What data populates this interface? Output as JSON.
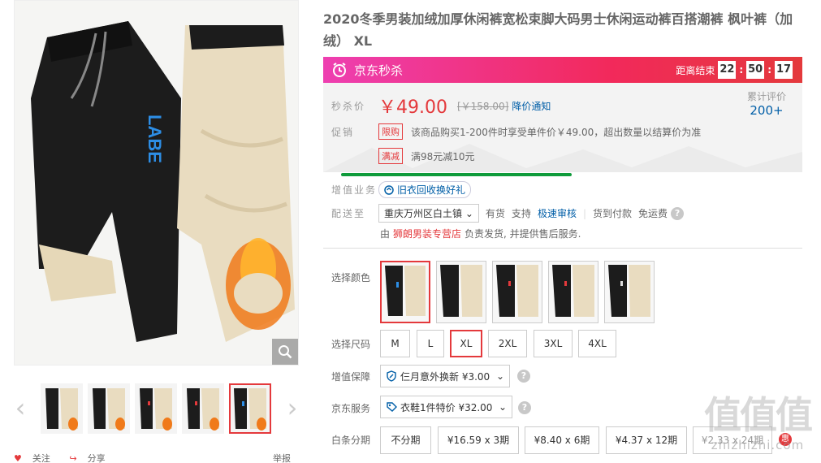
{
  "product": {
    "title": "2020冬季男装加绒加厚休闲裤宽松束脚大码男士休闲运动裤百搭潮裤 枫叶裤（加绒） XL"
  },
  "gallery": {
    "prev_arrow": "‹",
    "next_arrow": "›",
    "brand_print": "LABE",
    "share": {
      "follow": "关注",
      "share": "分享",
      "report": "举报"
    }
  },
  "seckill": {
    "label": "京东秒杀",
    "countdown_label": "距离结束",
    "hours": "22",
    "minutes": "50",
    "seconds": "17"
  },
  "price": {
    "label": "秒杀价",
    "current": "￥49.00",
    "original": "[￥158.00]",
    "notify": "降价通知",
    "reviews_label": "累计评价",
    "reviews_count": "200+"
  },
  "promo": {
    "label": "促销",
    "items": [
      {
        "tag": "限购",
        "text": "该商品购买1-200件时享受单件价￥49.00，超出数量以结算价为准"
      },
      {
        "tag": "满减",
        "text": "满98元减10元"
      }
    ]
  },
  "value_added": {
    "label": "增值业务",
    "service": "旧衣回收换好礼"
  },
  "delivery": {
    "label": "配送至",
    "location": "重庆万州区白土镇",
    "stock": "有货",
    "support_label": "支持",
    "fast_review": "极速审核",
    "cod": "货到付款",
    "free_shipping": "免运费",
    "seller_prefix": "由",
    "seller": "狮朗男装专营店",
    "seller_suffix": "负责发货, 并提供售后服务."
  },
  "options": {
    "color_label": "选择颜色",
    "colors": [
      "色1",
      "色2",
      "色3",
      "色4",
      "色5"
    ],
    "size_label": "选择尺码",
    "sizes": [
      "M",
      "L",
      "XL",
      "2XL",
      "3XL",
      "4XL"
    ],
    "selected_size": "XL",
    "warranty_label": "增值保障",
    "warranty_value": "仨月意外换新 ¥3.00",
    "jd_service_label": "京东服务",
    "jd_service_value": "衣鞋1件特价 ¥32.00",
    "installment_label": "白条分期",
    "installments": [
      "不分期",
      "¥16.59 x 3期",
      "¥8.40 x 6期",
      "¥4.37 x 12期",
      "¥2.33 x 24期"
    ],
    "installment_badge": "惠"
  },
  "watermark": {
    "glyph": "值值值",
    "url": "zhizhizhi.com"
  },
  "colors": {
    "accent": "#e4393c",
    "link": "#005ea7",
    "seckill_start": "#ee3fb1",
    "seckill_end": "#e4393c",
    "green_line": "#0f9b3b"
  }
}
